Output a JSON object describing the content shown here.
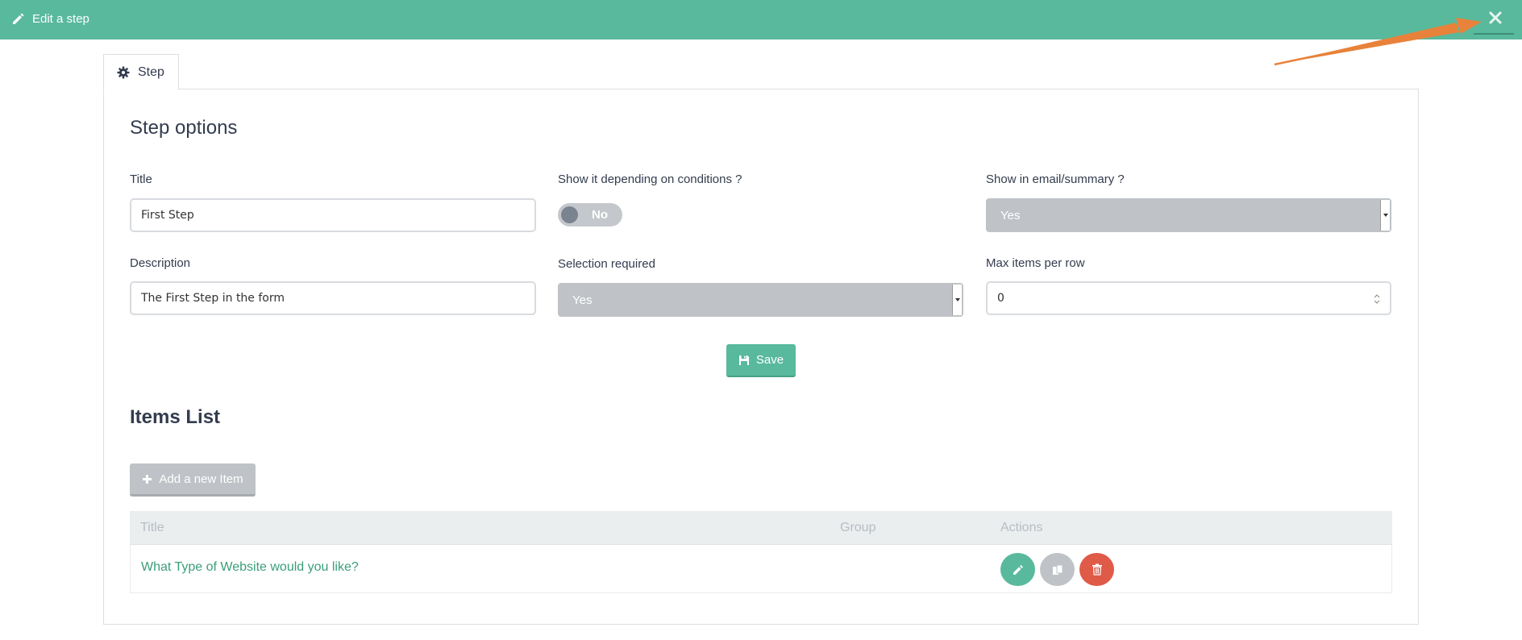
{
  "header": {
    "title": "Edit a step",
    "close_icon": "close-icon",
    "accent_color": "#59b99c"
  },
  "tab": {
    "label": "Step",
    "icon": "gear-icon"
  },
  "step_options": {
    "heading": "Step options",
    "title_label": "Title",
    "title_value": "First Step",
    "conditions_label": "Show it depending on conditions ?",
    "conditions_toggle": "No",
    "email_label": "Show in email/summary ?",
    "email_value": "Yes",
    "description_label": "Description",
    "description_value": "The First Step in the form",
    "selection_label": "Selection required",
    "selection_value": "Yes",
    "max_items_label": "Max items per row",
    "max_items_value": "0",
    "save_label": "Save"
  },
  "items_list": {
    "heading": "Items List",
    "add_label": "Add a new Item",
    "columns": [
      "Title",
      "Group",
      "Actions"
    ],
    "rows": [
      {
        "title": "What Type of Website would you like?",
        "group": ""
      }
    ]
  }
}
